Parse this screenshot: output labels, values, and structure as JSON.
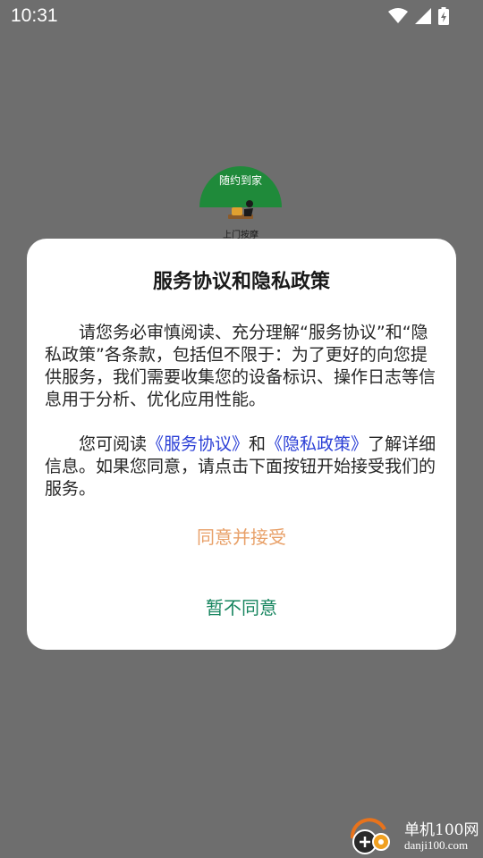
{
  "status_bar": {
    "time": "10:31",
    "icons": [
      "wifi-icon",
      "signal-icon",
      "battery-icon"
    ]
  },
  "splash": {
    "logo_title": "随约到家",
    "logo_subtitle": "上门按摩"
  },
  "dialog": {
    "title": "服务协议和隐私政策",
    "paragraph1": "请您务必审慎阅读、充分理解“服务协议”和“隐私政策”各条款，包括但不限于：为了更好的向您提供服务，我们需要收集您的设备标识、操作日志等信息用于分析、优化应用性能。",
    "paragraph2_prefix": "您可阅读",
    "service_link": "《服务协议》",
    "paragraph2_and": "和",
    "privacy_link": "《隐私政策》",
    "paragraph2_suffix": "了解详细信息。如果您同意，请点击下面按钮开始接受我们的服务。",
    "agree_label": "同意并接受",
    "disagree_label": "暂不同意"
  },
  "watermark": {
    "title": "单机100网",
    "url": "danji100.com"
  },
  "colors": {
    "overlay": "#6e6e6e",
    "agree": "#e8a068",
    "disagree": "#17855f",
    "link": "#2b3fd6",
    "logo_green": "#1f8a3a"
  }
}
